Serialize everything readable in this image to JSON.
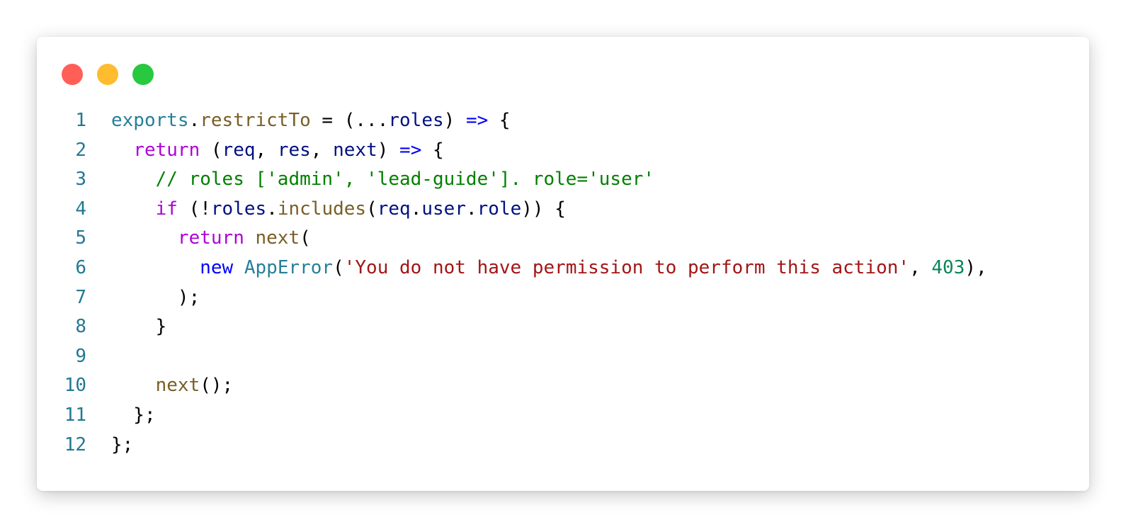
{
  "window_controls": [
    {
      "name": "close",
      "color": "#ff5f57"
    },
    {
      "name": "minimize",
      "color": "#febc2e"
    },
    {
      "name": "maximize",
      "color": "#28c840"
    }
  ],
  "colors": {
    "line_number": "#237893",
    "default": "#000000",
    "variable": "#267f99",
    "function": "#795e26",
    "param": "#001080",
    "keyword_blue": "#0000ff",
    "keyword_control": "#af00db",
    "comment": "#008000",
    "string": "#a31515",
    "number": "#098658"
  },
  "code": {
    "language": "javascript",
    "lines": [
      {
        "number": "1",
        "tokens": [
          {
            "text": "exports",
            "type": "variable"
          },
          {
            "text": ".",
            "type": "default"
          },
          {
            "text": "restrictTo",
            "type": "function"
          },
          {
            "text": " = (...",
            "type": "default"
          },
          {
            "text": "roles",
            "type": "param"
          },
          {
            "text": ") ",
            "type": "default"
          },
          {
            "text": "=>",
            "type": "keyword_blue"
          },
          {
            "text": " {",
            "type": "default"
          }
        ]
      },
      {
        "number": "2",
        "tokens": [
          {
            "text": "  ",
            "type": "default"
          },
          {
            "text": "return",
            "type": "keyword_control"
          },
          {
            "text": " (",
            "type": "default"
          },
          {
            "text": "req",
            "type": "param"
          },
          {
            "text": ", ",
            "type": "default"
          },
          {
            "text": "res",
            "type": "param"
          },
          {
            "text": ", ",
            "type": "default"
          },
          {
            "text": "next",
            "type": "param"
          },
          {
            "text": ") ",
            "type": "default"
          },
          {
            "text": "=>",
            "type": "keyword_blue"
          },
          {
            "text": " {",
            "type": "default"
          }
        ]
      },
      {
        "number": "3",
        "tokens": [
          {
            "text": "    ",
            "type": "default"
          },
          {
            "text": "// roles ['admin', 'lead-guide']. role='user'",
            "type": "comment"
          }
        ]
      },
      {
        "number": "4",
        "tokens": [
          {
            "text": "    ",
            "type": "default"
          },
          {
            "text": "if",
            "type": "keyword_control"
          },
          {
            "text": " (!",
            "type": "default"
          },
          {
            "text": "roles",
            "type": "param"
          },
          {
            "text": ".",
            "type": "default"
          },
          {
            "text": "includes",
            "type": "function"
          },
          {
            "text": "(",
            "type": "default"
          },
          {
            "text": "req",
            "type": "param"
          },
          {
            "text": ".",
            "type": "default"
          },
          {
            "text": "user",
            "type": "param"
          },
          {
            "text": ".",
            "type": "default"
          },
          {
            "text": "role",
            "type": "param"
          },
          {
            "text": ")) {",
            "type": "default"
          }
        ]
      },
      {
        "number": "5",
        "tokens": [
          {
            "text": "      ",
            "type": "default"
          },
          {
            "text": "return",
            "type": "keyword_control"
          },
          {
            "text": " ",
            "type": "default"
          },
          {
            "text": "next",
            "type": "function"
          },
          {
            "text": "(",
            "type": "default"
          }
        ]
      },
      {
        "number": "6",
        "tokens": [
          {
            "text": "        ",
            "type": "default"
          },
          {
            "text": "new",
            "type": "keyword_blue"
          },
          {
            "text": " ",
            "type": "default"
          },
          {
            "text": "AppError",
            "type": "variable"
          },
          {
            "text": "(",
            "type": "default"
          },
          {
            "text": "'You do not have permission to perform this action'",
            "type": "string"
          },
          {
            "text": ", ",
            "type": "default"
          },
          {
            "text": "403",
            "type": "number"
          },
          {
            "text": "),",
            "type": "default"
          }
        ]
      },
      {
        "number": "7",
        "tokens": [
          {
            "text": "      );",
            "type": "default"
          }
        ]
      },
      {
        "number": "8",
        "tokens": [
          {
            "text": "    }",
            "type": "default"
          }
        ]
      },
      {
        "number": "9",
        "tokens": []
      },
      {
        "number": "10",
        "tokens": [
          {
            "text": "    ",
            "type": "default"
          },
          {
            "text": "next",
            "type": "function"
          },
          {
            "text": "();",
            "type": "default"
          }
        ]
      },
      {
        "number": "11",
        "tokens": [
          {
            "text": "  };",
            "type": "default"
          }
        ]
      },
      {
        "number": "12",
        "tokens": [
          {
            "text": "};",
            "type": "default"
          }
        ]
      }
    ]
  }
}
